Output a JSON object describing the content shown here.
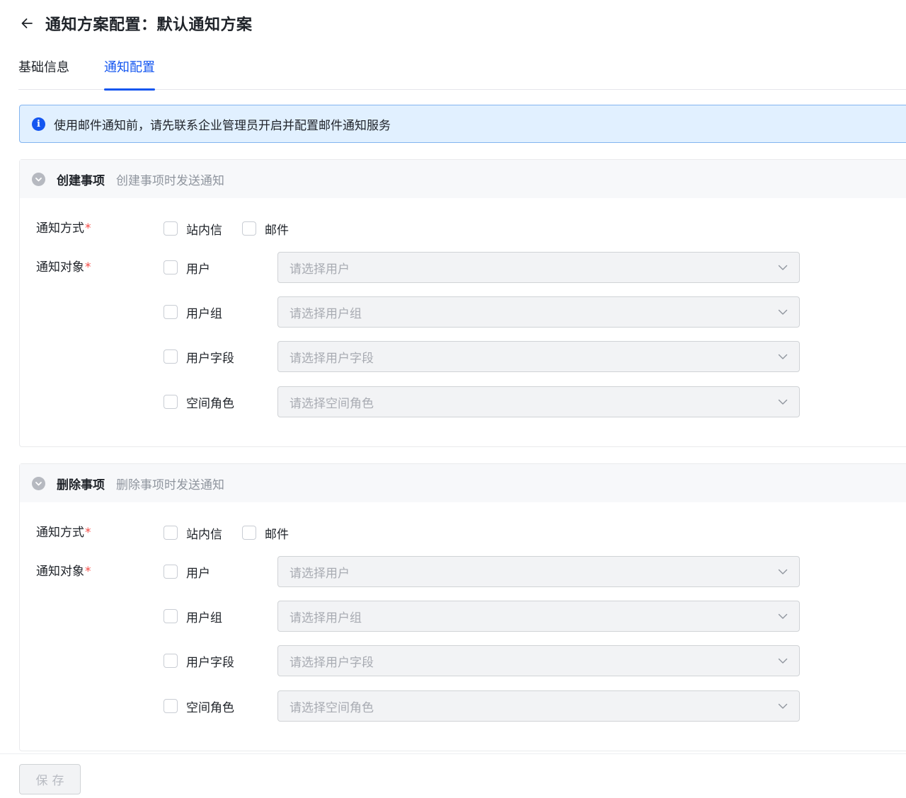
{
  "header": {
    "title": "通知方案配置：默认通知方案"
  },
  "tabs": [
    {
      "label": "基础信息",
      "active": false
    },
    {
      "label": "通知配置",
      "active": true
    }
  ],
  "alert": {
    "text": "使用邮件通知前，请先联系企业管理员开启并配置邮件通知服务"
  },
  "sections": [
    {
      "title": "创建事项",
      "description": "创建事项时发送通知",
      "method_label": "通知方式",
      "target_label": "通知对象",
      "required_mark": "*",
      "methods": [
        {
          "label": "站内信",
          "checked": false
        },
        {
          "label": "邮件",
          "checked": false
        }
      ],
      "targets": [
        {
          "label": "用户",
          "checked": false,
          "placeholder": "请选择用户"
        },
        {
          "label": "用户组",
          "checked": false,
          "placeholder": "请选择用户组"
        },
        {
          "label": "用户字段",
          "checked": false,
          "placeholder": "请选择用户字段"
        },
        {
          "label": "空间角色",
          "checked": false,
          "placeholder": "请选择空间角色"
        }
      ]
    },
    {
      "title": "删除事项",
      "description": "删除事项时发送通知",
      "method_label": "通知方式",
      "target_label": "通知对象",
      "required_mark": "*",
      "methods": [
        {
          "label": "站内信",
          "checked": false
        },
        {
          "label": "邮件",
          "checked": false
        }
      ],
      "targets": [
        {
          "label": "用户",
          "checked": false,
          "placeholder": "请选择用户"
        },
        {
          "label": "用户组",
          "checked": false,
          "placeholder": "请选择用户组"
        },
        {
          "label": "用户字段",
          "checked": false,
          "placeholder": "请选择用户字段"
        },
        {
          "label": "空间角色",
          "checked": false,
          "placeholder": "请选择空间角色"
        }
      ]
    }
  ],
  "footer": {
    "save_label": "保存",
    "save_enabled": false
  },
  "colors": {
    "primary": "#1456f0",
    "required": "#f54a45",
    "alert_bg": "#e1f0ff",
    "alert_border": "#82b4f0"
  }
}
